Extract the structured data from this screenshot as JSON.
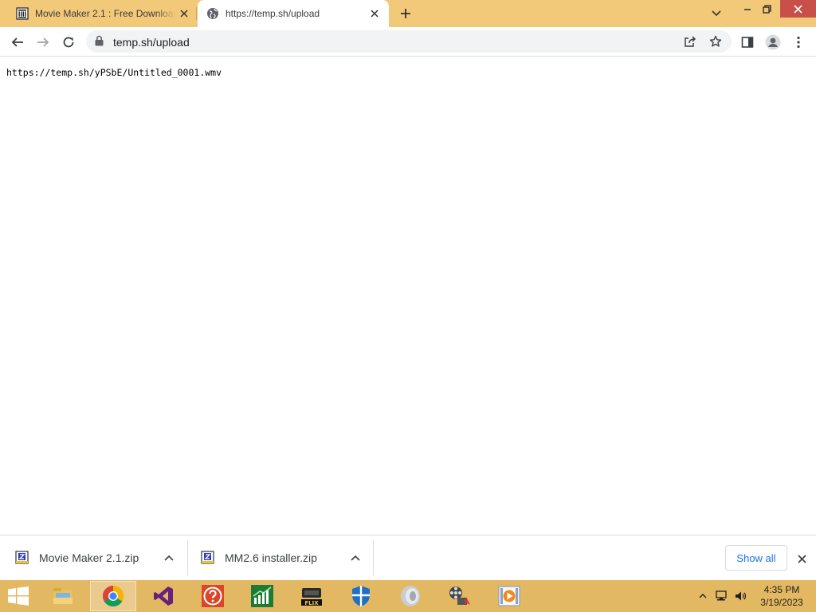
{
  "browser": {
    "tabs": [
      {
        "title": "Movie Maker 2.1 : Free Download",
        "favicon": "library-icon",
        "active": false
      },
      {
        "title": "https://temp.sh/upload",
        "favicon": "globe-icon",
        "active": true
      }
    ],
    "address": {
      "url": "temp.sh/upload",
      "icon": "lock-icon"
    },
    "toolbar_icons": [
      "back-icon",
      "forward-icon",
      "reload-icon",
      "share-icon",
      "star-icon",
      "side-panel-icon",
      "profile-icon",
      "menu-icon"
    ]
  },
  "page": {
    "body_text": "https://temp.sh/yPSbE/Untitled_0001.wmv"
  },
  "downloads": {
    "items": [
      {
        "name": "Movie Maker 2.1.zip",
        "icon": "zip-file-icon"
      },
      {
        "name": "MM2.6 installer.zip",
        "icon": "zip-file-icon"
      }
    ],
    "show_all_label": "Show all"
  },
  "taskbar": {
    "apps": [
      "file-explorer-icon",
      "chrome-icon",
      "visual-studio-icon",
      "help-icon",
      "chart-app-icon",
      "flixx-icon",
      "defender-icon",
      "speaker-app-icon",
      "movie-maker-icon",
      "video-player-icon"
    ],
    "clock": {
      "time": "4:35 PM",
      "date": "3/19/2023"
    }
  },
  "colors": {
    "tabstrip": "#f2c879",
    "taskbar": "#e3b862",
    "accent": "#1a73e8",
    "close_button": "#c7504a"
  }
}
